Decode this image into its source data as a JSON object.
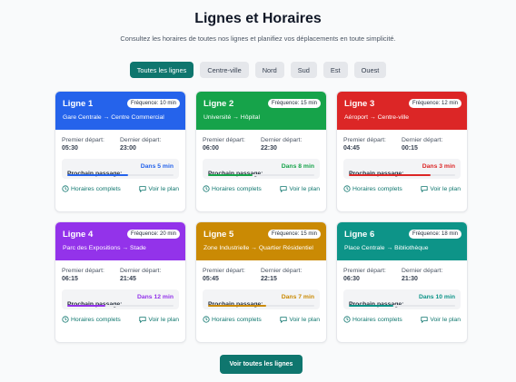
{
  "header": {
    "title": "Lignes et Horaires",
    "subtitle": "Consultez les horaires de toutes nos lignes et planifiez vos déplacements en toute simplicité."
  },
  "filters": [
    "Toutes les lignes",
    "Centre-ville",
    "Nord",
    "Sud",
    "Est",
    "Ouest"
  ],
  "filter_selected": "Toutes les lignes",
  "labels": {
    "first_departure": "Premier départ:",
    "last_departure": "Dernier départ:",
    "next_passage": "Prochain passage:",
    "full_schedule": "Horaires complets",
    "view_map": "Voir le plan"
  },
  "lines": [
    {
      "name": "Ligne 1",
      "frequency": "Fréquence: 10 min",
      "route": "Gare Centrale → Centre Commercial",
      "first": "05:30",
      "last": "23:00",
      "next": "Dans 5 min",
      "progress": 0.57,
      "color": "#2563eb"
    },
    {
      "name": "Ligne 2",
      "frequency": "Fréquence: 15 min",
      "route": "Université → Hôpital",
      "first": "06:00",
      "last": "22:30",
      "next": "Dans 8 min",
      "progress": 0.42,
      "color": "#16a34a"
    },
    {
      "name": "Ligne 3",
      "frequency": "Fréquence: 12 min",
      "route": "Aéroport → Centre-ville",
      "first": "04:45",
      "last": "00:15",
      "next": "Dans 3 min",
      "progress": 0.77,
      "color": "#dc2626"
    },
    {
      "name": "Ligne 4",
      "frequency": "Fréquence: 20 min",
      "route": "Parc des Expositions → Stade",
      "first": "06:15",
      "last": "21:45",
      "next": "Dans 12 min",
      "progress": 0.36,
      "color": "#9333ea"
    },
    {
      "name": "Ligne 5",
      "frequency": "Fréquence: 15 min",
      "route": "Zone Industrielle → Quartier Résidentiel",
      "first": "05:45",
      "last": "22:15",
      "next": "Dans 7 min",
      "progress": 0.55,
      "color": "#ca8a04"
    },
    {
      "name": "Ligne 6",
      "frequency": "Fréquence: 18 min",
      "route": "Place Centrale → Bibliothèque",
      "first": "06:30",
      "last": "21:30",
      "next": "Dans 10 min",
      "progress": 0.42,
      "color": "#0d9488"
    }
  ],
  "cta": "Voir toutes les lignes"
}
